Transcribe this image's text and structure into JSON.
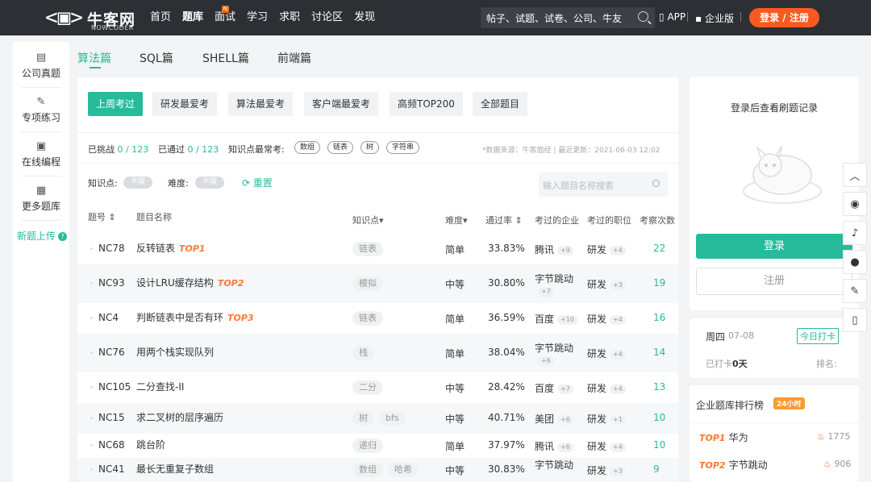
{
  "header": {
    "brand": "牛客网",
    "brand_sub": "NOWCODER",
    "nav": [
      {
        "label": "首页"
      },
      {
        "label": "题库",
        "active": true
      },
      {
        "label": "面试",
        "badge": "N"
      },
      {
        "label": "学习"
      },
      {
        "label": "求职"
      },
      {
        "label": "讨论区"
      },
      {
        "label": "发现"
      }
    ],
    "search_placeholder": "帖子、试题、试卷、公司、牛友",
    "app": "APP",
    "enterprise": "企业版",
    "login": "登录 / 注册"
  },
  "sidebar": {
    "items": [
      {
        "label": "公司真题",
        "icon": "document-icon"
      },
      {
        "label": "专项练习",
        "icon": "pencil-icon"
      },
      {
        "label": "在线编程",
        "icon": "code-icon"
      },
      {
        "label": "更多题库",
        "icon": "grid-icon"
      }
    ],
    "new_upload": "新题上传",
    "new_upload_icon": "?"
  },
  "categories": [
    {
      "label": "算法篇",
      "active": true
    },
    {
      "label": "SQL篇"
    },
    {
      "label": "SHELL篇"
    },
    {
      "label": "前端篇"
    }
  ],
  "tabs": [
    {
      "label": "上周考过",
      "active": true
    },
    {
      "label": "研发最爱考"
    },
    {
      "label": "算法最爱考"
    },
    {
      "label": "客户端最爱考"
    },
    {
      "label": "高频TOP200"
    },
    {
      "label": "全部题目"
    }
  ],
  "stats": {
    "challenged_label": "已挑战",
    "challenged": "0 / 123",
    "passed_label": "已通过",
    "passed": "0 / 123",
    "kp_label": "知识点最常考:",
    "kp_chips": [
      "数组",
      "链表",
      "树",
      "字符串"
    ],
    "source": "*数据来源：牛客面经 | 最近更新：2021-06-03 12:02"
  },
  "filters": {
    "kp_label": "知识点:",
    "kp_value": "不限",
    "diff_label": "难度:",
    "diff_value": "不限",
    "reset": "重置",
    "search_placeholder": "输入题目名称搜索"
  },
  "table": {
    "headers": {
      "id": "题号",
      "name": "题目名称",
      "kp": "知识点",
      "diff": "难度",
      "rate": "通过率",
      "company": "考过的企业",
      "job": "考过的职位",
      "count": "考察次数"
    },
    "rows": [
      {
        "id": "NC78",
        "name": "反转链表",
        "top": "TOP1",
        "tags": [
          "链表"
        ],
        "diff": "简单",
        "rate": "33.83%",
        "company": "腾讯",
        "company_plus": "+9",
        "job": "研发",
        "job_plus": "+4",
        "count": "22"
      },
      {
        "id": "NC93",
        "name": "设计LRU缓存结构",
        "top": "TOP2",
        "tags": [
          "模拟"
        ],
        "diff": "中等",
        "rate": "30.80%",
        "company": "字节跳动",
        "company_plus": "+7",
        "job": "研发",
        "job_plus": "+3",
        "count": "19"
      },
      {
        "id": "NC4",
        "name": "判断链表中是否有环",
        "top": "TOP3",
        "tags": [
          "链表"
        ],
        "diff": "简单",
        "rate": "36.59%",
        "company": "百度",
        "company_plus": "+10",
        "job": "研发",
        "job_plus": "+4",
        "count": "16"
      },
      {
        "id": "NC76",
        "name": "用两个栈实现队列",
        "top": "",
        "tags": [
          "栈"
        ],
        "diff": "简单",
        "rate": "38.04%",
        "company": "字节跳动",
        "company_plus": "+6",
        "job": "研发",
        "job_plus": "+4",
        "count": "14"
      },
      {
        "id": "NC105",
        "name": "二分查找-II",
        "top": "",
        "tags": [
          "二分"
        ],
        "diff": "中等",
        "rate": "28.42%",
        "company": "百度",
        "company_plus": "+7",
        "job": "研发",
        "job_plus": "+4",
        "count": "13"
      },
      {
        "id": "NC15",
        "name": "求二叉树的层序遍历",
        "top": "",
        "tags": [
          "树",
          "bfs"
        ],
        "diff": "中等",
        "rate": "40.71%",
        "company": "美团",
        "company_plus": "+6",
        "job": "研发",
        "job_plus": "+1",
        "count": "10"
      },
      {
        "id": "NC68",
        "name": "跳台阶",
        "top": "",
        "tags": [
          "递归"
        ],
        "diff": "简单",
        "rate": "37.97%",
        "company": "腾讯",
        "company_plus": "+6",
        "job": "研发",
        "job_plus": "+4",
        "count": "10"
      },
      {
        "id": "NC41",
        "name": "最长无重复子数组",
        "top": "",
        "tags": [
          "数组",
          "哈希"
        ],
        "diff": "中等",
        "rate": "30.83%",
        "company": "字节跳动",
        "company_plus": "",
        "job": "研发",
        "job_plus": "+3",
        "count": "9"
      }
    ]
  },
  "right": {
    "prompt": "登录后查看刷题记录",
    "login": "登录",
    "register": "注册",
    "day": "周四",
    "date": "07-08",
    "checkin": "今日打卡",
    "checked": "已打卡",
    "checked_days": "0天",
    "rank_label": "排名:",
    "board_title": "企业题库排行榜",
    "board_badge": "24小时",
    "board": [
      {
        "top": "TOP1",
        "name": "华为",
        "count": "1775"
      },
      {
        "top": "TOP2",
        "name": "字节跳动",
        "count": "906"
      }
    ]
  },
  "colors": {
    "accent": "#25bb9b",
    "orange": "#fa5a20",
    "top": "#ff7830"
  }
}
